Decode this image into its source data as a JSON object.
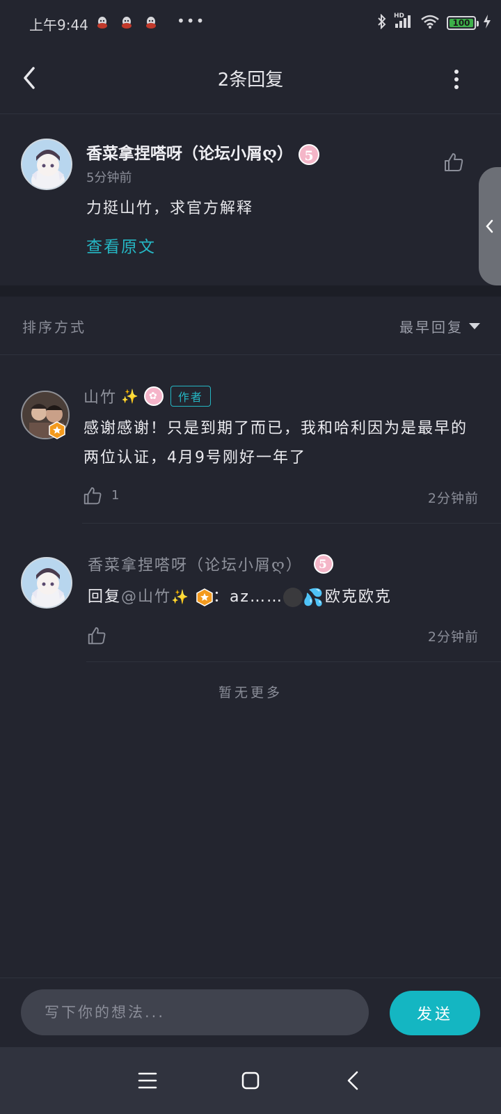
{
  "status_bar": {
    "time": "上午9:44",
    "notifications": [
      "qq-icon",
      "qq-icon",
      "qq-icon"
    ],
    "more": "•••",
    "battery": "100",
    "network": "HD"
  },
  "header": {
    "title": "2条回复"
  },
  "main_comment": {
    "author": "香菜拿捏嗒呀（论坛小屑ღ）",
    "level": "5",
    "time": "5分钟前",
    "text": "力挺山竹，求官方解释",
    "view_original": "查看原文"
  },
  "sort": {
    "label": "排序方式",
    "selected": "最早回复"
  },
  "replies": [
    {
      "author": "山竹",
      "author_tag": "作者",
      "text": "感谢感谢！只是到期了而已，我和哈利因为是最早的两位认证，4月9号刚好一年了",
      "likes": "1",
      "time": "2分钟前"
    },
    {
      "author": "香菜拿捏嗒呀（论坛小屑ღ）",
      "level": "5",
      "reply_prefix": "回复",
      "mention": "@山竹",
      "text_tail": "：az……",
      "text_end": "欧克欧克",
      "time": "2分钟前"
    }
  ],
  "footer_note": "暂无更多",
  "input": {
    "placeholder": "写下你的想法...",
    "send_label": "发送"
  },
  "colors": {
    "background": "#23252f",
    "accent": "#14b6c2",
    "link": "#25b7c4",
    "muted": "#8b8e99"
  }
}
